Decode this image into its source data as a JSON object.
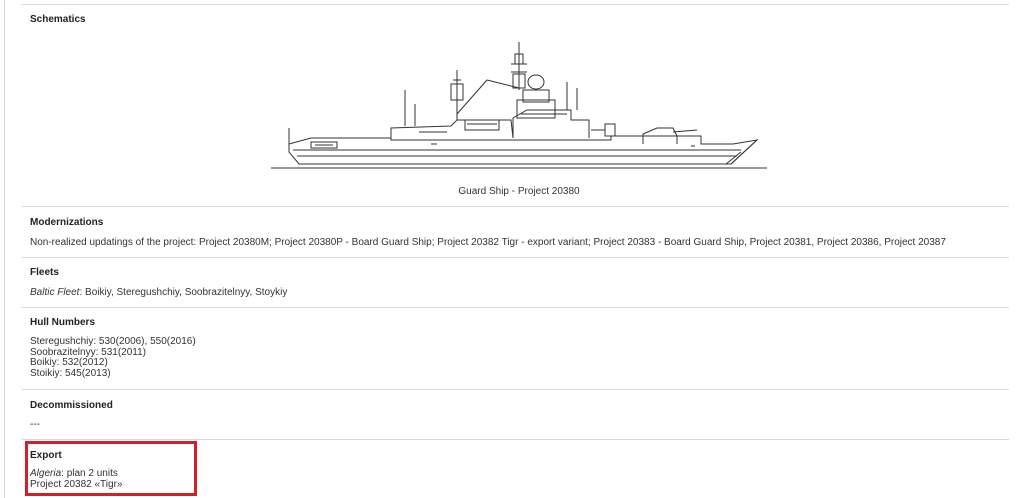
{
  "schematics": {
    "title": "Schematics",
    "caption": "Guard Ship - Project 20380",
    "image_icon": "ship-schematic"
  },
  "modernizations": {
    "title": "Modernizations",
    "text": "Non-realized updatings of the project: Project 20380M; Project 20380P - Board Guard Ship; Project 20382 Tigr - export variant; Project 20383 - Board Guard Ship, Project 20381, Project 20386, Project 20387"
  },
  "fleets": {
    "title": "Fleets",
    "fleet_name": "Baltic Fleet",
    "ships": ": Boikiy, Steregushchiy, Soobrazitelnyy, Stoykiy"
  },
  "hull_numbers": {
    "title": "Hull Numbers",
    "lines": [
      "Steregushchiy: 530(2006), 550(2016)",
      "Soobrazitelnyy: 531(2011)",
      "Boikiy: 532(2012)",
      "Stoikiy: 545(2013)"
    ]
  },
  "decommissioned": {
    "title": "Decommissioned",
    "text": "---"
  },
  "export": {
    "title": "Export",
    "country": "Algeria",
    "plan": ": plan 2 units",
    "project": "Project 20382 «Tigr»",
    "highlight_color": "#d0202a"
  }
}
